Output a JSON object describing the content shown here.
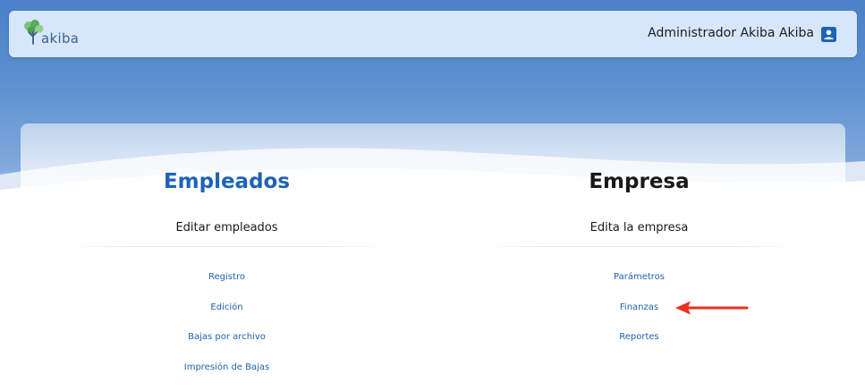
{
  "header": {
    "logo_text": "akiba",
    "user_name": "Administrador Akiba Akiba",
    "user_icon": "user-card-icon"
  },
  "colors": {
    "accent": "#1d63b8",
    "link": "#2062b0",
    "header_bg": "#d7e7fb",
    "arrow": "#e8321f"
  },
  "sections": {
    "employees": {
      "title": "Empleados",
      "subtitle": "Editar empleados",
      "links": [
        "Registro",
        "Edición",
        "Bajas por archivo",
        "Impresión de Bajas"
      ]
    },
    "company": {
      "title": "Empresa",
      "subtitle": "Edita la empresa",
      "links": [
        "Parámetros",
        "Finanzas",
        "Reportes"
      ]
    }
  },
  "annotation": {
    "arrow_target": "Finanzas",
    "arrow_icon": "red-arrow-left-icon"
  }
}
